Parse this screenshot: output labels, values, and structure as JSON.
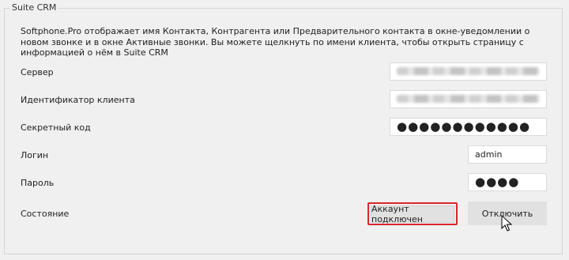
{
  "group": {
    "title": "Suite CRM"
  },
  "description": "Softphone.Pro отображает имя Контакта, Контрагента или Предварительного контакта в окне-уведомлении о новом звонке и в окне Активные звонки. Вы можете щелкнуть по имени клиента, чтобы открыть страницу с информацией о нём в Suite CRM",
  "fields": {
    "server": {
      "label": "Сервер",
      "value": ""
    },
    "client_id": {
      "label": "Идентификатор клиента",
      "value": ""
    },
    "secret": {
      "label": "Секретный код",
      "value": "●●●●●●●●●●●●"
    },
    "login": {
      "label": "Логин",
      "value": "admin"
    },
    "password": {
      "label": "Пароль",
      "value": "●●●●"
    }
  },
  "status": {
    "label": "Состояние",
    "value": "Аккаунт подключен"
  },
  "buttons": {
    "disconnect": "Отключить"
  },
  "colors": {
    "highlight": "#d9272c",
    "background": "#f0f0f0"
  }
}
